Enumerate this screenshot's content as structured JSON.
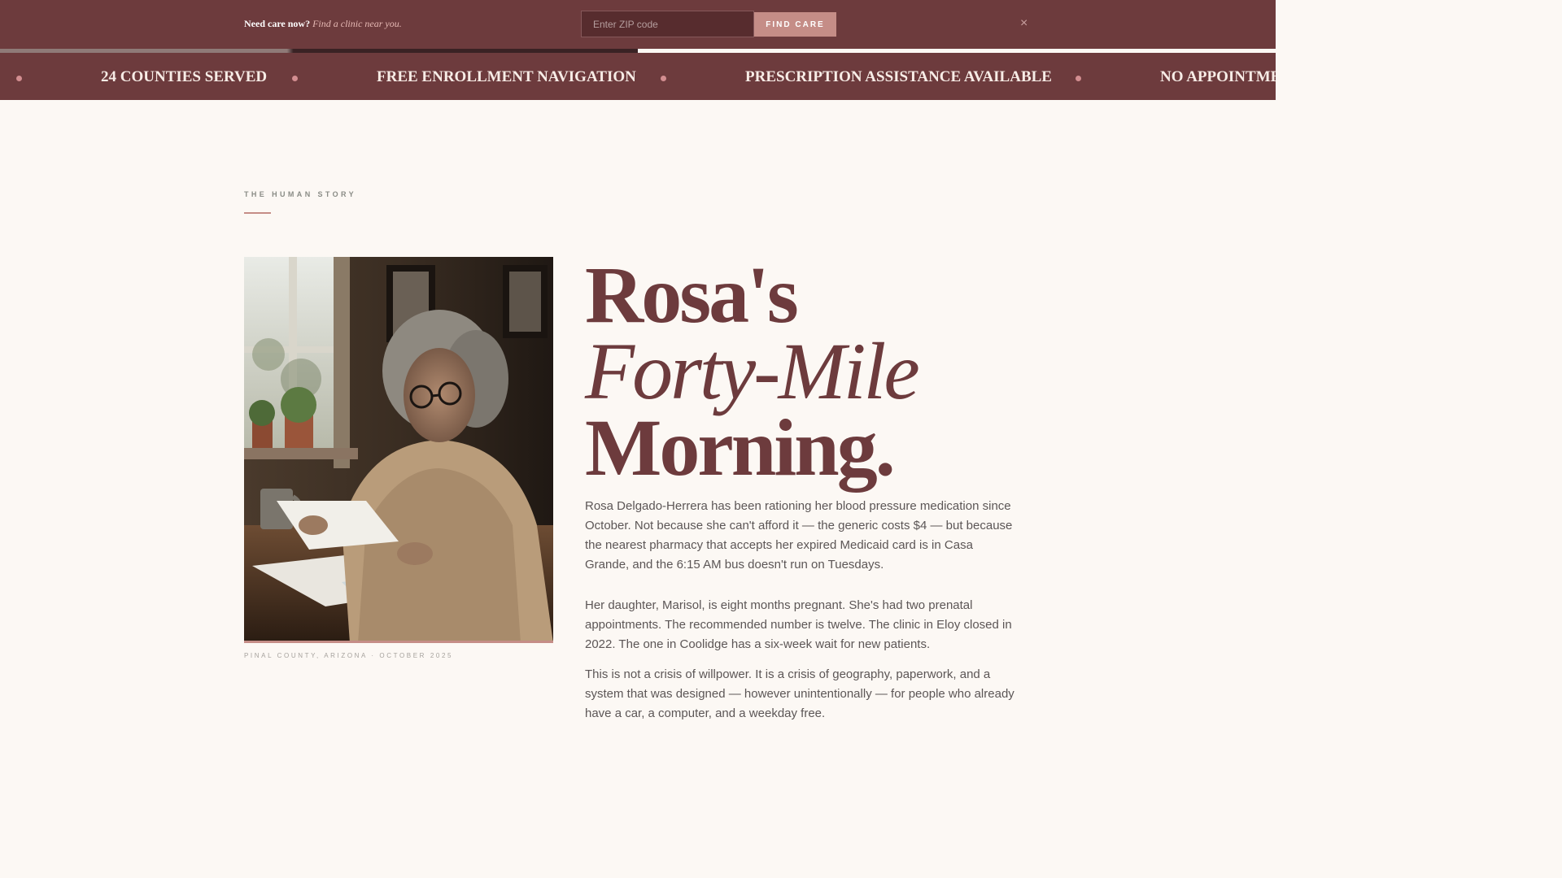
{
  "alert_bar": {
    "lead": "Need care now?",
    "sub": "Find a clinic near you.",
    "zip_placeholder": "Enter ZIP code",
    "button": "FIND CARE",
    "close": "×"
  },
  "progress": {
    "value": 0.5
  },
  "ticker": [
    "24 COUNTIES SERVED",
    "FREE ENROLLMENT NAVIGATION",
    "PRESCRIPTION ASSISTANCE AVAILABLE",
    "NO APPOINTME"
  ],
  "section": {
    "eyebrow": "THE HUMAN STORY"
  },
  "photo": {
    "caption": "PINAL COUNTY, ARIZONA · OCTOBER 2025"
  },
  "headline": {
    "line1": "Rosa's",
    "line2": "Forty-Mile",
    "line3": "Morning."
  },
  "paragraphs": [
    "Rosa Delgado-Herrera has been rationing her blood pressure medication since October. Not because she can't afford it — the generic costs $4 — but because the nearest pharmacy that accepts her expired Medicaid card is in Casa Grande, and the 6:15 AM bus doesn't run on Tuesdays.",
    "Her daughter, Marisol, is eight months pregnant. She's had two prenatal appointments. The recommended number is twelve. The clinic in Eloy closed in 2022. The one in Coolidge has a six-week wait for new patients.",
    "This is not a crisis of willpower. It is a crisis of geography, paperwork, and a system that was designed — however unintentionally — for people who already have a car, a computer, and a weekday free."
  ]
}
